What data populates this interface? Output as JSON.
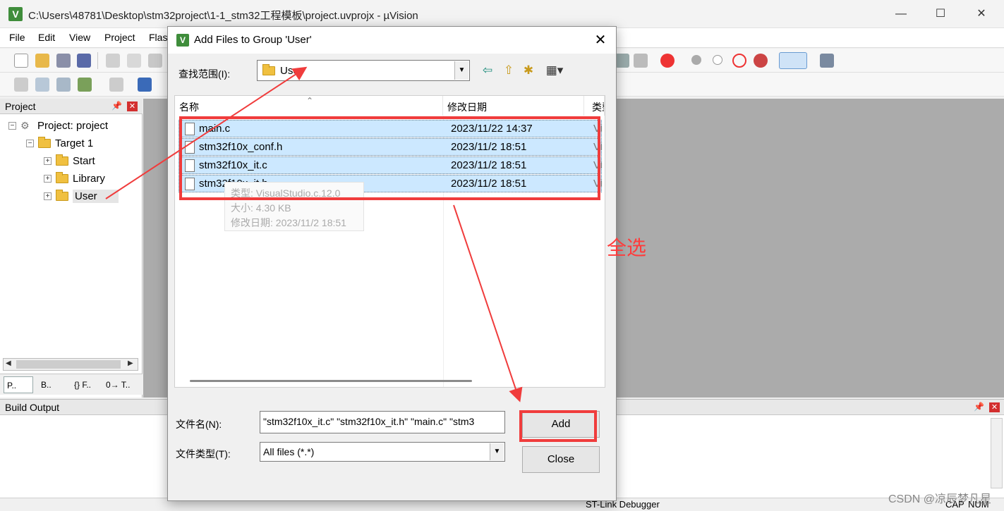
{
  "window": {
    "title": "C:\\Users\\48781\\Desktop\\stm32project\\1-1_stm32工程模板\\project.uvprojx - µVision",
    "app_icon": "V",
    "minimize": "—",
    "maximize": "☐",
    "close": "✕"
  },
  "menu": [
    "File",
    "Edit",
    "View",
    "Project",
    "Flash"
  ],
  "project_panel": {
    "title": "Project",
    "pin": "📌",
    "close": "✕",
    "tree": {
      "root": "Project: project",
      "target": "Target 1",
      "groups": [
        "Start",
        "Library",
        "User"
      ]
    },
    "tabs": [
      "P..",
      "B..",
      "{} F..",
      "0→ T.."
    ]
  },
  "build_output": {
    "title": "Build Output",
    "pin": "📌",
    "close": "✕"
  },
  "status": {
    "debugger": "ST-Link Debugger",
    "caps": "CAP",
    "num": "NUM"
  },
  "dialog": {
    "title": "Add Files to Group 'User'",
    "close": "✕",
    "look_in_label": "查找范围(I):",
    "look_in_value": "User",
    "columns": [
      "名称",
      "修改日期",
      "类型"
    ],
    "files": [
      {
        "name": "main.c",
        "date": "2023/11/22 14:37",
        "type": "Vis"
      },
      {
        "name": "stm32f10x_conf.h",
        "date": "2023/11/2 18:51",
        "type": "Vis"
      },
      {
        "name": "stm32f10x_it.c",
        "date": "2023/11/2 18:51",
        "type": "Vis"
      },
      {
        "name": "stm32f10x_it.h",
        "date": "2023/11/2 18:51",
        "type": "Vis"
      }
    ],
    "tooltip": {
      "type_line": "类型: VisualStudio.c.12.0",
      "size_line": "大小: 4.30 KB",
      "date_line": "修改日期: 2023/11/2 18:51"
    },
    "filename_label": "文件名(N):",
    "filename_value": "\"stm32f10x_it.c\" \"stm32f10x_it.h\" \"main.c\" \"stm3",
    "filetype_label": "文件类型(T):",
    "filetype_value": "All files (*.*)",
    "add_button": "Add",
    "close_button": "Close"
  },
  "annotation": {
    "select_all": "全选",
    "color": "#f03c3c"
  },
  "watermark": "CSDN @凉辰梦凡星"
}
